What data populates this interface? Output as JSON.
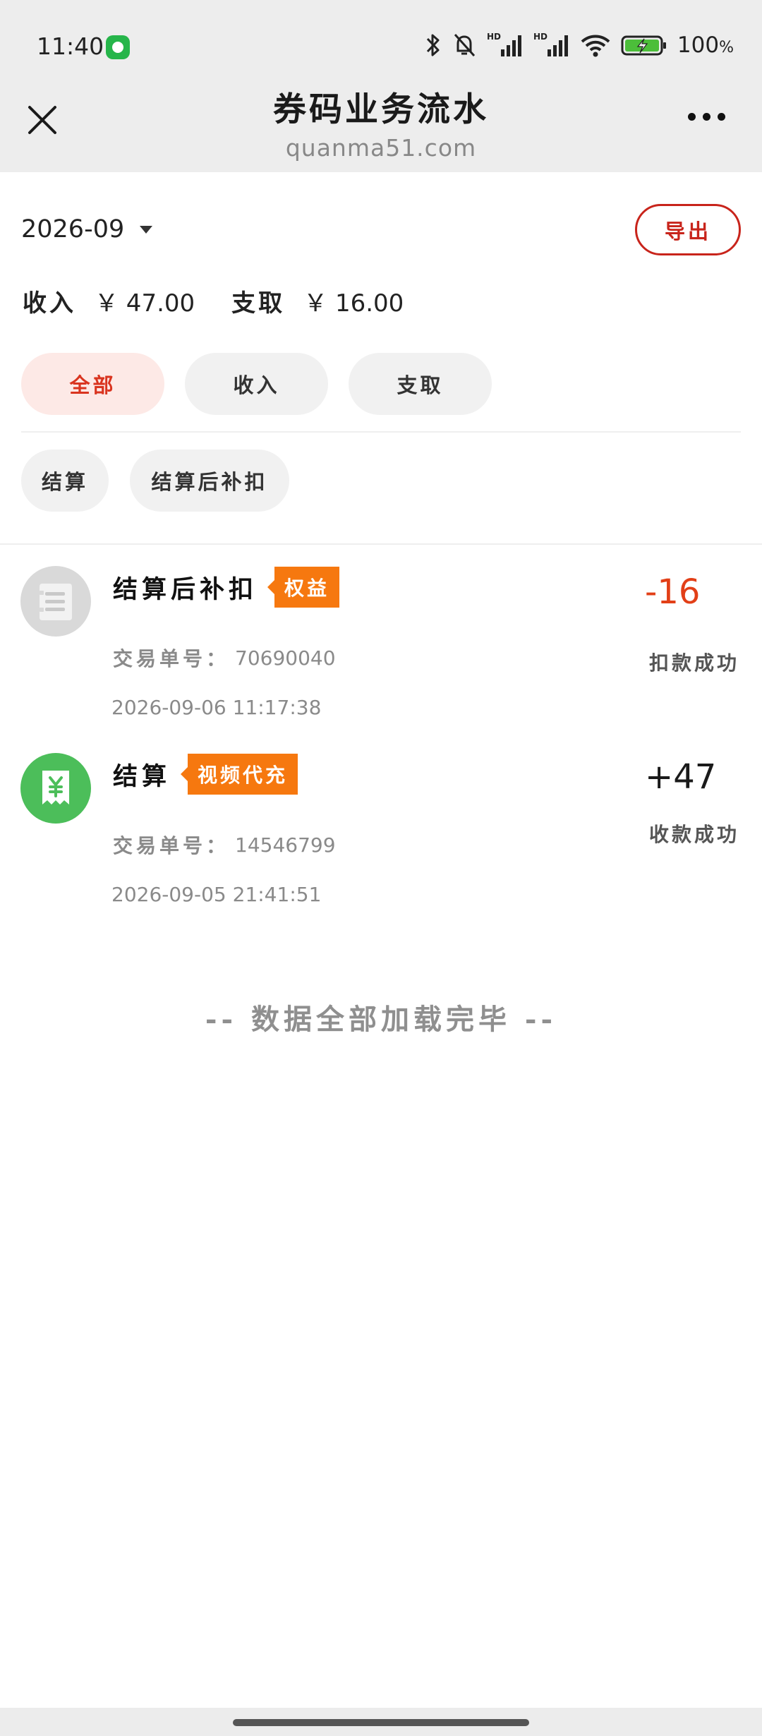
{
  "status_bar": {
    "time": "11:40",
    "battery": "100",
    "battery_unit": "%"
  },
  "nav": {
    "title": "券码业务流水",
    "subtitle": "quanma51.com"
  },
  "filter": {
    "month": "2026-09",
    "export_label": "导出"
  },
  "summary": {
    "income_label": "收入",
    "income_value": "￥ 47.00",
    "expense_label": "支取",
    "expense_value": "￥ 16.00"
  },
  "tabs": {
    "type": [
      {
        "label": "全部",
        "active": true
      },
      {
        "label": "收入",
        "active": false
      },
      {
        "label": "支取",
        "active": false
      }
    ],
    "category": [
      {
        "label": "结算"
      },
      {
        "label": "结算后补扣"
      }
    ]
  },
  "transactions": [
    {
      "icon": "receipt-list-icon",
      "title": "结算后补扣",
      "tag": "权益",
      "order_label": "交易单号：",
      "order_no": "70690040",
      "time": "2026-09-06 11:17:38",
      "amount": "-16",
      "status": "扣款成功"
    },
    {
      "icon": "yuan-receipt-icon",
      "title": "结算",
      "tag": "视频代充",
      "order_label": "交易单号：",
      "order_no": "14546799",
      "time": "2026-09-05 21:41:51",
      "amount": "+47",
      "status": "收款成功"
    }
  ],
  "end_note": "-- 数据全部加载完毕 --",
  "colors": {
    "accent_red": "#c8241b",
    "negative_amount": "#e23f17",
    "tag_orange": "#f6780f",
    "active_tab_bg": "#fde9e6",
    "income_icon_green": "#4cbe5a"
  }
}
